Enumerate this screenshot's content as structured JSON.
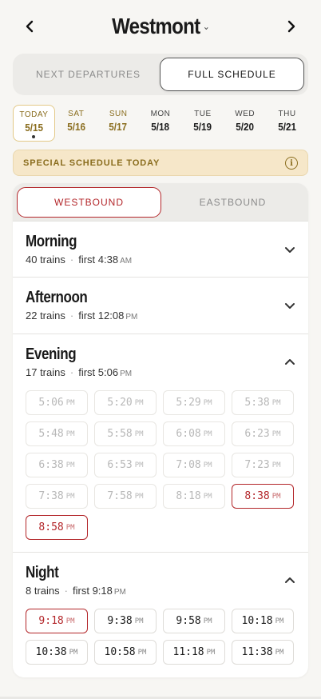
{
  "header": {
    "station": "Westmont",
    "prev_icon": "chevron-left-icon",
    "next_icon": "chevron-right-icon",
    "dropdown_icon": "caret-down-icon"
  },
  "mode_tabs": [
    {
      "label": "NEXT DEPARTURES",
      "active": false
    },
    {
      "label": "FULL SCHEDULE",
      "active": true
    }
  ],
  "days": [
    {
      "dow": "TODAY",
      "date": "5/15",
      "today": true,
      "weekend": false
    },
    {
      "dow": "SAT",
      "date": "5/16",
      "today": false,
      "weekend": true
    },
    {
      "dow": "SUN",
      "date": "5/17",
      "today": false,
      "weekend": true
    },
    {
      "dow": "MON",
      "date": "5/18",
      "today": false,
      "weekend": false
    },
    {
      "dow": "TUE",
      "date": "5/19",
      "today": false,
      "weekend": false
    },
    {
      "dow": "WED",
      "date": "5/20",
      "today": false,
      "weekend": false
    },
    {
      "dow": "THU",
      "date": "5/21",
      "today": false,
      "weekend": false
    }
  ],
  "banner": {
    "text": "SPECIAL SCHEDULE TODAY",
    "icon": "info-icon"
  },
  "direction_tabs": [
    {
      "label": "WESTBOUND",
      "active": true
    },
    {
      "label": "EASTBOUND",
      "active": false
    }
  ],
  "colors": {
    "accent": "#b3262a",
    "gold": "#8a6d1e",
    "banner_bg": "#f6e7c9"
  },
  "sections": [
    {
      "title": "Morning",
      "count": "40 trains",
      "first_prefix": "first",
      "first_time": "4:38",
      "first_ampm": "AM",
      "expanded": false,
      "times": []
    },
    {
      "title": "Afternoon",
      "count": "22 trains",
      "first_prefix": "first",
      "first_time": "12:08",
      "first_ampm": "PM",
      "expanded": false,
      "times": []
    },
    {
      "title": "Evening",
      "count": "17 trains",
      "first_prefix": "first",
      "first_time": "5:06",
      "first_ampm": "PM",
      "expanded": true,
      "times": [
        {
          "t": "5:06",
          "ap": "PM",
          "state": "past"
        },
        {
          "t": "5:20",
          "ap": "PM",
          "state": "past"
        },
        {
          "t": "5:29",
          "ap": "PM",
          "state": "past"
        },
        {
          "t": "5:38",
          "ap": "PM",
          "state": "past"
        },
        {
          "t": "5:48",
          "ap": "PM",
          "state": "past"
        },
        {
          "t": "5:58",
          "ap": "PM",
          "state": "past"
        },
        {
          "t": "6:08",
          "ap": "PM",
          "state": "past"
        },
        {
          "t": "6:23",
          "ap": "PM",
          "state": "past"
        },
        {
          "t": "6:38",
          "ap": "PM",
          "state": "past"
        },
        {
          "t": "6:53",
          "ap": "PM",
          "state": "past"
        },
        {
          "t": "7:08",
          "ap": "PM",
          "state": "past"
        },
        {
          "t": "7:23",
          "ap": "PM",
          "state": "past"
        },
        {
          "t": "7:38",
          "ap": "PM",
          "state": "past"
        },
        {
          "t": "7:58",
          "ap": "PM",
          "state": "past"
        },
        {
          "t": "8:18",
          "ap": "PM",
          "state": "past"
        },
        {
          "t": "8:38",
          "ap": "PM",
          "state": "active"
        },
        {
          "t": "8:58",
          "ap": "PM",
          "state": "active"
        }
      ]
    },
    {
      "title": "Night",
      "count": "8 trains",
      "first_prefix": "first",
      "first_time": "9:18",
      "first_ampm": "PM",
      "expanded": true,
      "times": [
        {
          "t": "9:18",
          "ap": "PM",
          "state": "active"
        },
        {
          "t": "9:38",
          "ap": "PM",
          "state": "future"
        },
        {
          "t": "9:58",
          "ap": "PM",
          "state": "future"
        },
        {
          "t": "10:18",
          "ap": "PM",
          "state": "future"
        },
        {
          "t": "10:38",
          "ap": "PM",
          "state": "future"
        },
        {
          "t": "10:58",
          "ap": "PM",
          "state": "future"
        },
        {
          "t": "11:18",
          "ap": "PM",
          "state": "future"
        },
        {
          "t": "11:38",
          "ap": "PM",
          "state": "future"
        }
      ]
    }
  ]
}
